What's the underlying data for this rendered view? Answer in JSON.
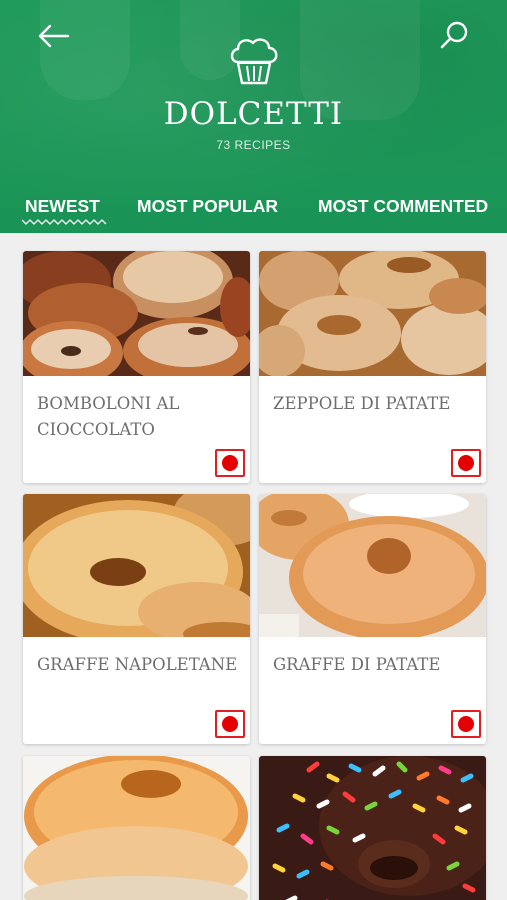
{
  "header": {
    "title": "DOLCETTI",
    "recipe_count": "73 RECIPES",
    "back_icon": "arrow-left-icon",
    "search_icon": "search-icon",
    "logo_icon": "muffin-icon",
    "background_color": "#1f9a5a"
  },
  "tabs": [
    {
      "label": "NEWEST",
      "selected": true
    },
    {
      "label": "MOST POPULAR",
      "selected": false
    },
    {
      "label": "MOST COMMENTED",
      "selected": false
    }
  ],
  "recipes": [
    {
      "name": "BOMBOLONI AL CIOCCOLATO",
      "badge_icon": "italian-flag-icon"
    },
    {
      "name": "ZEPPOLE DI PATATE",
      "badge_icon": "italian-flag-icon"
    },
    {
      "name": "GRAFFE NAPOLETANE",
      "badge_icon": "italian-flag-icon"
    },
    {
      "name": "GRAFFE DI PATATE",
      "badge_icon": "italian-flag-icon"
    },
    {
      "name": "",
      "badge_icon": ""
    },
    {
      "name": "",
      "badge_icon": ""
    }
  ],
  "colors": {
    "accent_green": "#1f9a5a",
    "badge_red": "#e40000",
    "card_text": "#6e6e6e"
  }
}
